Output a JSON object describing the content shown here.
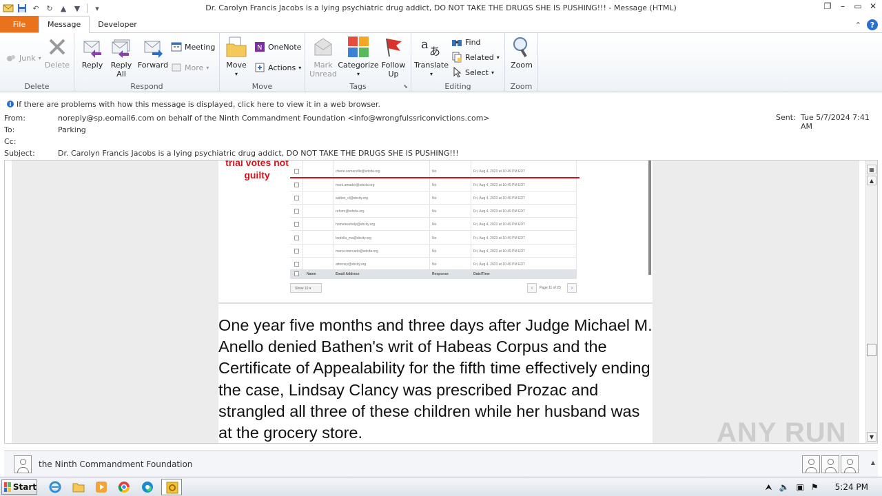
{
  "window": {
    "title": "Dr. Carolyn Francis Jacobs is a lying psychiatric drug addict, DO NOT TAKE THE DRUGS SHE IS PUSHING!!!  -  Message (HTML)"
  },
  "tabs": [
    {
      "label": "File"
    },
    {
      "label": "Message"
    },
    {
      "label": "Developer"
    }
  ],
  "ribbon": {
    "delete_group": {
      "label": "Delete",
      "junk": "Junk",
      "delete": "Delete"
    },
    "respond_group": {
      "label": "Respond",
      "reply": "Reply",
      "reply_all_1": "Reply",
      "reply_all_2": "All",
      "forward": "Forward",
      "meeting": "Meeting",
      "more": "More"
    },
    "move_group": {
      "label": "Move",
      "move": "Move",
      "onenote": "OneNote",
      "actions": "Actions"
    },
    "tags_group": {
      "label": "Tags",
      "mark_unread_1": "Mark",
      "mark_unread_2": "Unread",
      "categorize": "Categorize",
      "follow_up_1": "Follow",
      "follow_up_2": "Up"
    },
    "editing_group": {
      "label": "Editing",
      "translate": "Translate",
      "find": "Find",
      "related": "Related",
      "select": "Select"
    },
    "zoom_group": {
      "label": "Zoom",
      "zoom": "Zoom"
    }
  },
  "header": {
    "info": "If there are problems with how this message is displayed, click here to view it in a web browser.",
    "from_label": "From:",
    "from_value": "noreply@sp.eomail6.com on behalf of the Ninth Commandment Foundation <info@wrongfulssriconvictions.com>",
    "to_label": "To:",
    "to_value": "Parking",
    "cc_label": "Cc:",
    "subject_label": "Subject:",
    "subject_value": "Dr. Carolyn Francis Jacobs is a lying psychiatric drug addict, DO NOT TAKE THE DRUGS SHE IS PUSHING!!!",
    "sent_label": "Sent:",
    "sent_value": "Tue 5/7/2024 7:41 AM"
  },
  "body": {
    "annotation": "trial votes not guilty",
    "table_rows": [
      {
        "email": "cherie.somerville@sdcda.org",
        "response": "No",
        "datetime": "Fri, Aug 4, 2023 at 10:49 PM EDT"
      },
      {
        "email": "mark.amador@sdcda.org",
        "response": "No",
        "datetime": "Fri, Aug 4, 2023 at 10:49 PM EDT"
      },
      {
        "email": "walton_cl@sbcity.org",
        "response": "No",
        "datetime": "Fri, Aug 4, 2023 at 10:49 PM EDT"
      },
      {
        "email": "reform@sdcda.org",
        "response": "No",
        "datetime": "Fri, Aug 4, 2023 at 10:49 PM EDT"
      },
      {
        "email": "homelesshelp@sbcity.org",
        "response": "No",
        "datetime": "Fri, Aug 4, 2023 at 10:49 PM EDT"
      },
      {
        "email": "bedolla_ma@sbcity.org",
        "response": "No",
        "datetime": "Fri, Aug 4, 2023 at 10:49 PM EDT"
      },
      {
        "email": "marco.mercado@sdcda.org",
        "response": "No",
        "datetime": "Fri, Aug 4, 2023 at 10:49 PM EDT"
      },
      {
        "email": "attorney@sbcity.org",
        "response": "No",
        "datetime": "Fri, Aug 4, 2023 at 10:49 PM EDT"
      }
    ],
    "table_headers": {
      "name": "Name",
      "email": "Email Address",
      "response": "Response",
      "datetime": "Date/Time"
    },
    "pager": {
      "show": "Show 10",
      "page": "Page 11 of 23"
    },
    "paragraph": "One year five months and three days after Judge Michael M. Anello denied Bathen's writ of Habeas Corpus and the Certificate of Appealability for the fifth time effectively ending the case, Lindsay Clancy was prescribed Prozac and strangled all three of these children while her husband was at the grocery store."
  },
  "people_pane": {
    "name": "the Ninth Commandment Foundation"
  },
  "watermark": "ANY RUN",
  "taskbar": {
    "start": "Start",
    "clock": "5:24 PM"
  },
  "colors": {
    "file_tab": "#e8731c",
    "annotation_red": "#d4141c",
    "accent_blue": "#2a6fc9"
  }
}
